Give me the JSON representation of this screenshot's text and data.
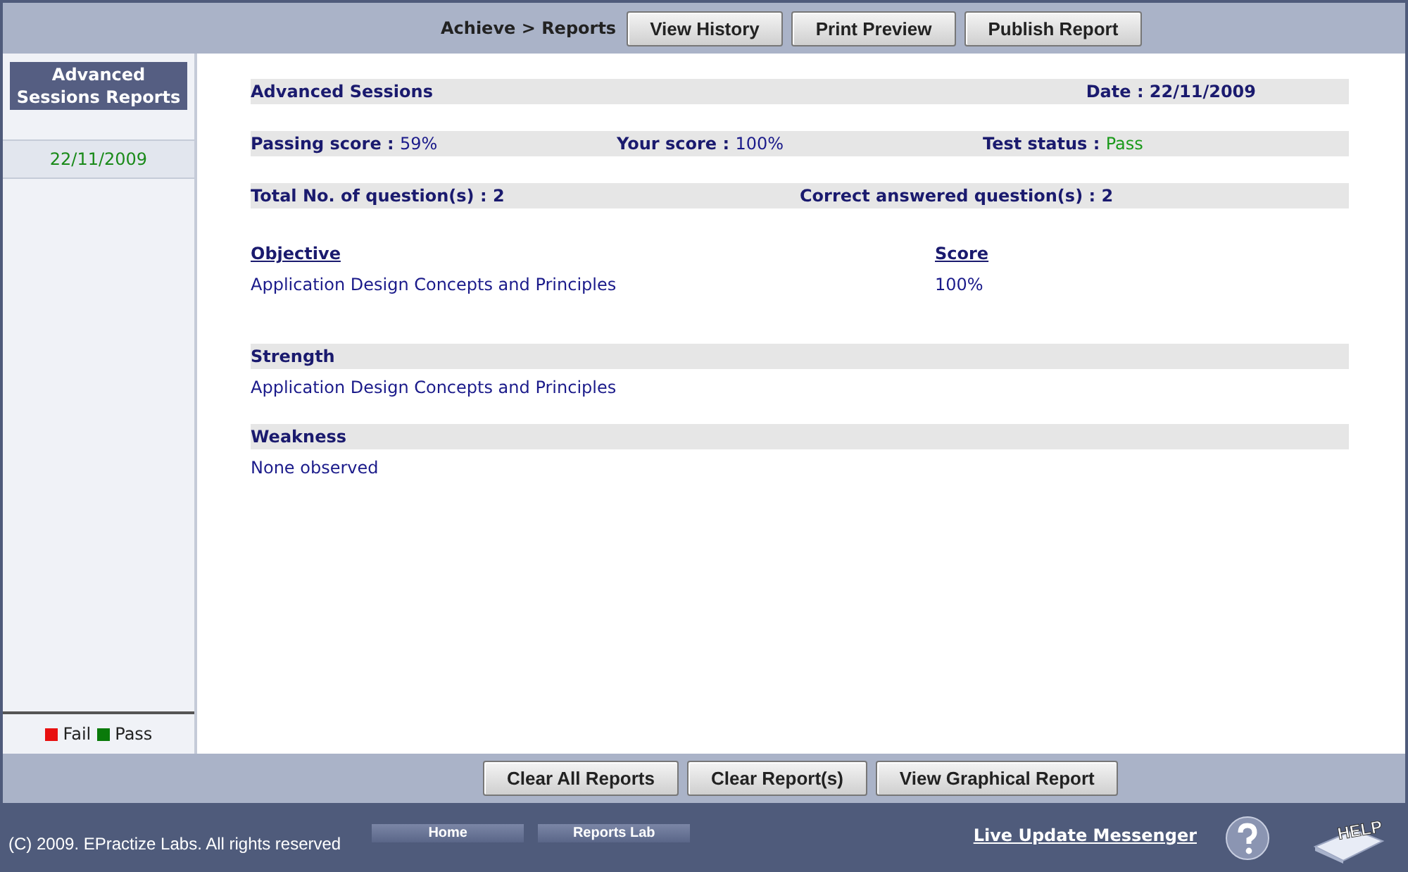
{
  "toolbar": {
    "breadcrumb": "Achieve > Reports",
    "buttons": [
      "View History",
      "Print Preview",
      "Publish Report"
    ]
  },
  "sidebar": {
    "title": "Advanced Sessions Reports",
    "items": [
      {
        "label": "22/11/2009",
        "selected": true,
        "color": "#1a8a1a"
      }
    ],
    "legend": [
      {
        "label": "Fail",
        "color": "#e81010"
      },
      {
        "label": "Pass",
        "color": "#0a7a0a"
      }
    ]
  },
  "report": {
    "title": "Advanced Sessions",
    "date": "Date : 22/11/2009",
    "stats": [
      {
        "label": "Passing score :",
        "value": "59%",
        "kind": "plain"
      },
      {
        "label": "Your score :",
        "value": "100%",
        "kind": "plain"
      },
      {
        "label": "Test status :",
        "value": "Pass",
        "kind": "status"
      }
    ],
    "counts": [
      "Total No. of question(s) : 2",
      "Correct answered question(s) : 2"
    ],
    "columns": [
      "Objective",
      "Score"
    ],
    "rows": [
      [
        "Application Design Concepts and Principles",
        "100%"
      ]
    ],
    "sections": [
      {
        "heading": "Strength",
        "text": "Application Design Concepts and Principles"
      },
      {
        "heading": "Weakness",
        "text": "None observed"
      }
    ]
  },
  "actions": [
    "Clear All Reports",
    "Clear Report(s)",
    "View Graphical Report"
  ],
  "footer": {
    "copyright": "(C) 2009. EPractize Labs. All rights reserved",
    "links": [
      "Home",
      "Reports Lab"
    ],
    "messenger": "Live Update Messenger",
    "help": "HELP"
  }
}
